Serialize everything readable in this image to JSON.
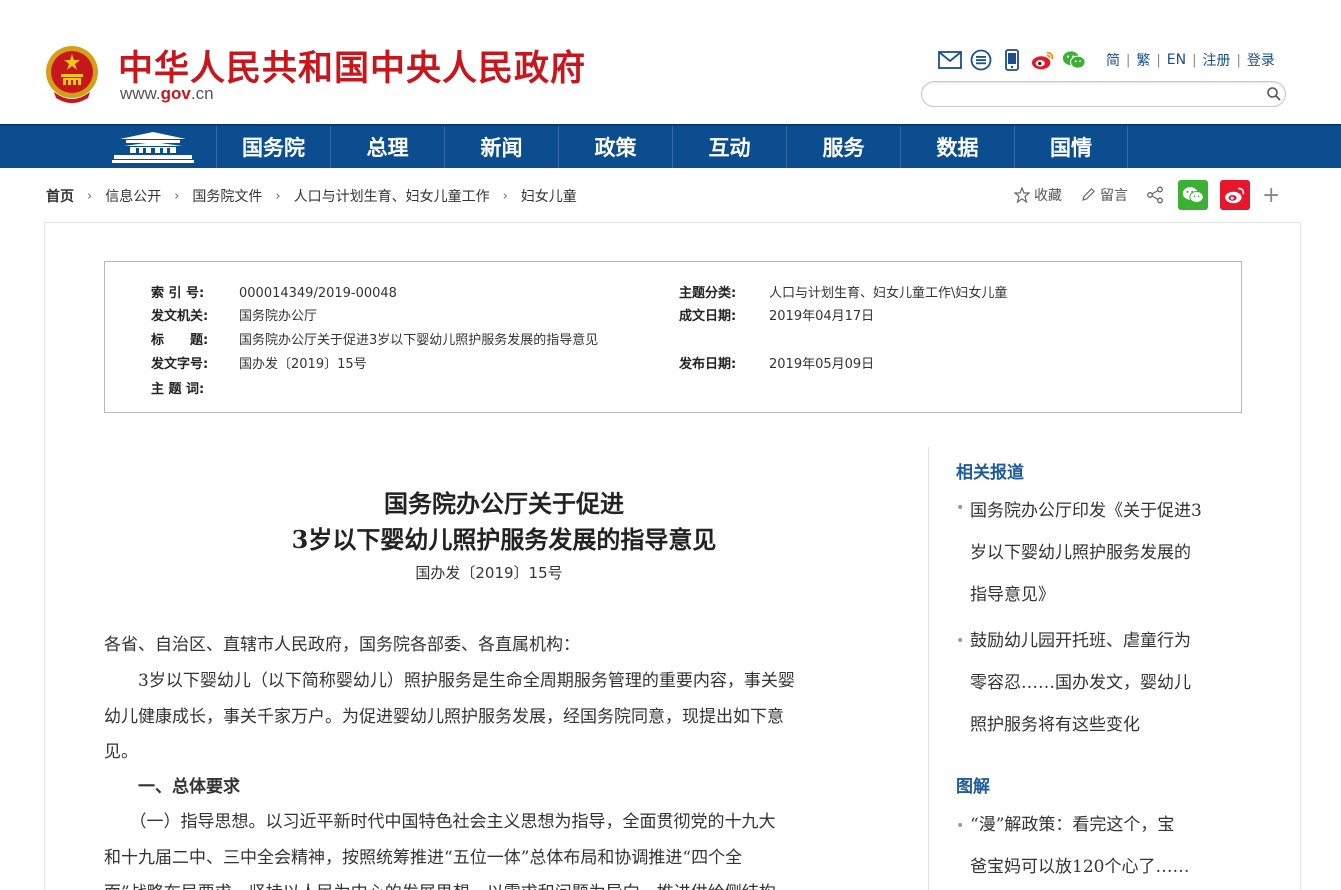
{
  "header": {
    "site_title": "中华人民共和国中央人民政府",
    "domain_prefix": "www.",
    "domain_main": "gov",
    "domain_suffix": ".cn",
    "lang_links": [
      "简",
      "繁",
      "EN",
      "注册",
      "登录"
    ],
    "tool_icons": [
      "mail-icon",
      "rss-icon",
      "mobile-icon",
      "weibo-icon",
      "wechat-icon"
    ],
    "search_placeholder": ""
  },
  "nav": {
    "items": [
      "国务院",
      "总理",
      "新闻",
      "政策",
      "互动",
      "服务",
      "数据",
      "国情"
    ]
  },
  "breadcrumb": [
    "首页",
    "信息公开",
    "国务院文件",
    "人口与计划生育、妇女儿童工作",
    "妇女儿童"
  ],
  "actions": {
    "favorite": "收藏",
    "comment": "留言"
  },
  "info": {
    "index_label": "索 引 号:",
    "index_value": "000014349/2019-00048",
    "issuer_label": "发文机关:",
    "issuer_value": "国务院办公厅",
    "title_label": "标　　题:",
    "title_value": "国务院办公厅关于促进3岁以下婴幼儿照护服务发展的指导意见",
    "docno_label": "发文字号:",
    "docno_value": "国办发〔2019〕15号",
    "keywords_label": "主 题 词:",
    "topic_label": "主题分类:",
    "topic_value": "人口与计划生育、妇女儿童工作\\妇女儿童",
    "written_label": "成文日期:",
    "written_value": "2019年04月17日",
    "published_label": "发布日期:",
    "published_value": "2019年05月09日"
  },
  "article": {
    "title_line1": "国务院办公厅关于促进",
    "title_line2": "3岁以下婴幼儿照护服务发展的指导意见",
    "doc_number": "国办发〔2019〕15号",
    "paragraphs": [
      "各省、自治区、直辖市人民政府，国务院各部委、各直属机构：",
      "　　3岁以下婴幼儿（以下简称婴幼儿）照护服务是生命全周期服务管理的重要内容，事关婴",
      "幼儿健康成长，事关千家万户。为促进婴幼儿照护服务发展，经国务院同意，现提出如下意",
      "见。",
      "　　一、总体要求",
      "　　（一）指导思想。以习近平新时代中国特色社会主义思想为指导，全面贯彻党的十九大",
      "和十九届二中、三中全会精神，按照统筹推进“五位一体”总体布局和协调推进“四个全",
      "面”战略布局要求，坚持以人民为中心的发展思想，以需求和问题为导向，推进供给侧结构"
    ]
  },
  "sidebar": {
    "related_heading": "相关报道",
    "related": [
      [
        "国务院办公厅印发《关于促进3",
        "岁以下婴幼儿照护服务发展的",
        "指导意见》"
      ],
      [
        "鼓励幼儿园开托班、虐童行为",
        "零容忍……国办发文，婴幼儿",
        "照护服务将有这些变化"
      ]
    ],
    "graphic_heading": "图解",
    "graphic": [
      [
        "“漫”解政策：看完这个，宝",
        "爸宝妈可以放120个心了……"
      ]
    ]
  }
}
